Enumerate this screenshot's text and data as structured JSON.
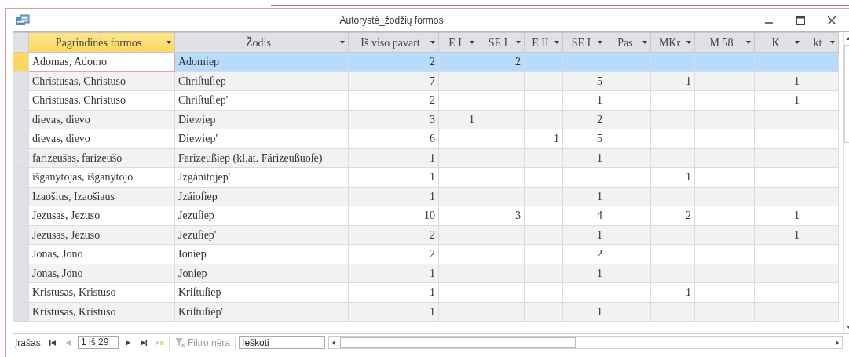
{
  "window": {
    "title": "Autorystė_žodžių formos"
  },
  "table": {
    "columns": [
      {
        "label": "Pagrindinės formos",
        "selected": true,
        "kind": "text"
      },
      {
        "label": "Žodis",
        "selected": false,
        "kind": "text"
      },
      {
        "label": "Iš viso pavart",
        "selected": false,
        "kind": "number"
      },
      {
        "label": "E I",
        "selected": false,
        "kind": "number"
      },
      {
        "label": "SE I",
        "selected": false,
        "kind": "number"
      },
      {
        "label": "E II",
        "selected": false,
        "kind": "number"
      },
      {
        "label": "SE I",
        "selected": false,
        "kind": "number"
      },
      {
        "label": "Pas",
        "selected": false,
        "kind": "number"
      },
      {
        "label": "MKr",
        "selected": false,
        "kind": "number"
      },
      {
        "label": "M 58",
        "selected": false,
        "kind": "number"
      },
      {
        "label": "K",
        "selected": false,
        "kind": "number"
      },
      {
        "label": "kt",
        "selected": false,
        "kind": "number"
      }
    ],
    "rows": [
      {
        "selected": true,
        "editing": true,
        "cells": [
          "Adomas, Adomo",
          "Adomiep",
          "2",
          null,
          "2",
          null,
          null,
          null,
          null,
          null,
          null,
          null
        ]
      },
      {
        "selected": false,
        "editing": false,
        "cells": [
          "Christusas, Christuso",
          "Chriſtuſiep",
          "7",
          null,
          null,
          null,
          "5",
          null,
          "1",
          null,
          "1",
          null
        ]
      },
      {
        "selected": false,
        "editing": false,
        "cells": [
          "Christusas, Christuso",
          "Chriſtuſiep'",
          "2",
          null,
          null,
          null,
          "1",
          null,
          null,
          null,
          "1",
          null
        ]
      },
      {
        "selected": false,
        "editing": false,
        "cells": [
          "dievas, dievo",
          "Diewiep",
          "3",
          "1",
          null,
          null,
          "2",
          null,
          null,
          null,
          null,
          null
        ]
      },
      {
        "selected": false,
        "editing": false,
        "cells": [
          "dievas, dievo",
          "Diewiep'",
          "6",
          null,
          null,
          "1",
          "5",
          null,
          null,
          null,
          null,
          null
        ]
      },
      {
        "selected": false,
        "editing": false,
        "cells": [
          "farizeušas, farizeušo",
          "Farizeußiep (kl.at. Fárizeußuoſe)",
          "1",
          null,
          null,
          null,
          "1",
          null,
          null,
          null,
          null,
          null
        ]
      },
      {
        "selected": false,
        "editing": false,
        "cells": [
          "išganytojas, išganytojo",
          "Jżgánitojep'",
          "1",
          null,
          null,
          null,
          null,
          null,
          "1",
          null,
          null,
          null
        ]
      },
      {
        "selected": false,
        "editing": false,
        "cells": [
          "Izaošius, Izaošiaus",
          "Jzáioſiep",
          "1",
          null,
          null,
          null,
          "1",
          null,
          null,
          null,
          null,
          null
        ]
      },
      {
        "selected": false,
        "editing": false,
        "cells": [
          "Jezusas, Jezuso",
          "Jezuſiep",
          "10",
          null,
          "3",
          null,
          "4",
          null,
          "2",
          null,
          "1",
          null
        ]
      },
      {
        "selected": false,
        "editing": false,
        "cells": [
          "Jezusas, Jezuso",
          "Jezuſiep'",
          "2",
          null,
          null,
          null,
          "1",
          null,
          null,
          null,
          "1",
          null
        ]
      },
      {
        "selected": false,
        "editing": false,
        "cells": [
          "Jonas, Jono",
          "Ioniep",
          "2",
          null,
          null,
          null,
          "2",
          null,
          null,
          null,
          null,
          null
        ]
      },
      {
        "selected": false,
        "editing": false,
        "cells": [
          "Jonas, Jono",
          "Joniep",
          "1",
          null,
          null,
          null,
          "1",
          null,
          null,
          null,
          null,
          null
        ]
      },
      {
        "selected": false,
        "editing": false,
        "cells": [
          "Kristusas, Kristuso",
          "Kriſtuſiep",
          "1",
          null,
          null,
          null,
          null,
          null,
          "1",
          null,
          null,
          null
        ]
      },
      {
        "selected": false,
        "editing": false,
        "cells": [
          "Kristusas, Kristuso",
          "Kriſtuſiep'",
          "1",
          null,
          null,
          null,
          "1",
          null,
          null,
          null,
          null,
          null
        ]
      }
    ]
  },
  "navigation": {
    "label": "Įrašas:",
    "position": "1 iš 29",
    "filter": {
      "label": "Filtro nėra",
      "disabled": true
    },
    "search": {
      "placeholder": "Ieškoti"
    }
  }
}
